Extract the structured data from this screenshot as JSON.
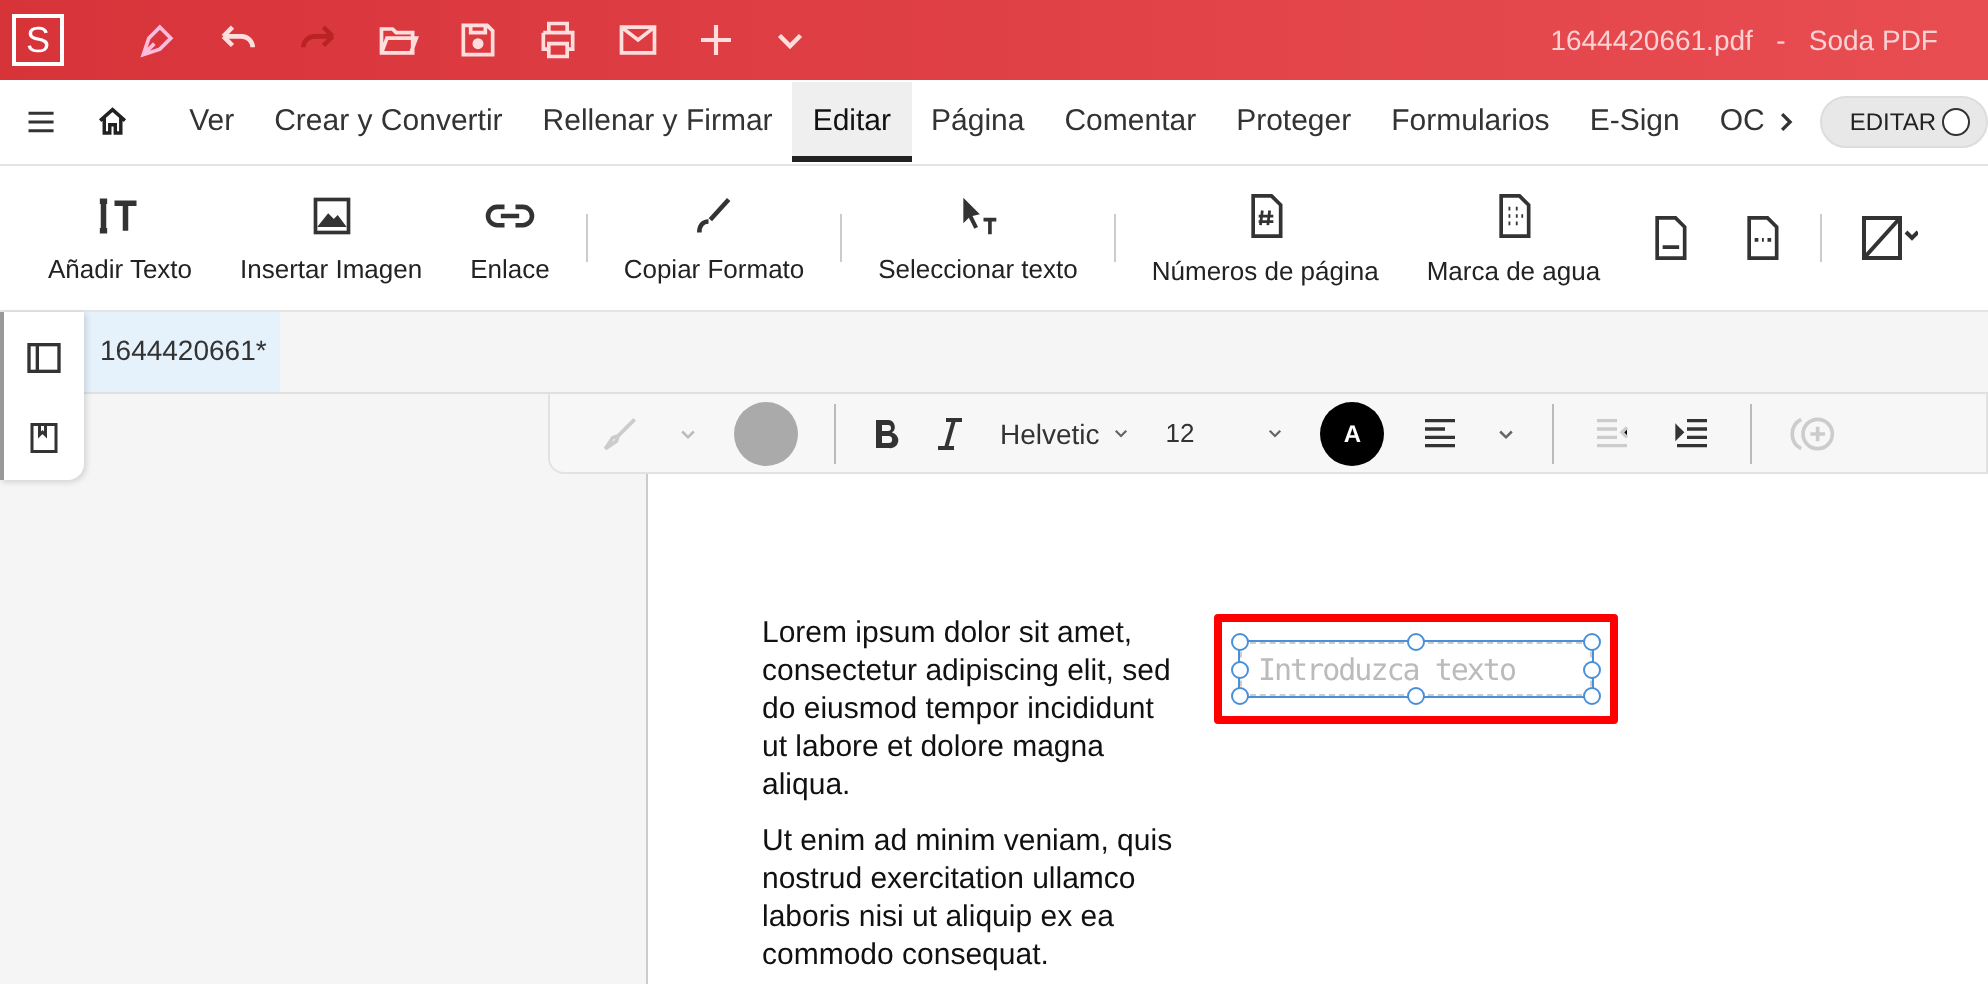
{
  "window": {
    "logo": "S",
    "title": "1644420661.pdf   -   Soda PDF"
  },
  "menu": {
    "tabs": [
      {
        "label": "Ver",
        "selected": false
      },
      {
        "label": "Crear y Convertir",
        "selected": false
      },
      {
        "label": "Rellenar y Firmar",
        "selected": false
      },
      {
        "label": "Editar",
        "selected": true
      },
      {
        "label": "Página",
        "selected": false
      },
      {
        "label": "Comentar",
        "selected": false
      },
      {
        "label": "Proteger",
        "selected": false
      },
      {
        "label": "Formularios",
        "selected": false
      },
      {
        "label": "E-Sign",
        "selected": false
      },
      {
        "label": "OC",
        "selected": false
      }
    ],
    "edit_toggle": {
      "label": "EDITAR",
      "on": false
    }
  },
  "ribbon": [
    {
      "label": "Añadir Texto"
    },
    {
      "label": "Insertar Imagen"
    },
    {
      "label": "Enlace"
    },
    {
      "label": "Copiar Formato"
    },
    {
      "label": "Seleccionar texto"
    },
    {
      "label": "Números de página"
    },
    {
      "label": "Marca de agua"
    }
  ],
  "document_tab": {
    "label": "1644420661*",
    "selected": true
  },
  "format_bar": {
    "highlighter_disabled": true,
    "fill_disabled": true,
    "font": "Helvetic",
    "size": "12",
    "text_color_label": "A",
    "outdent_disabled": true
  },
  "page": {
    "paragraphs": [
      "Lorem ipsum dolor sit amet, consectetur adipiscing elit, sed do eiusmod tempor incididunt ut labore et dolore magna aliqua.",
      "Ut enim ad minim veniam, quis nostrud exercitation ullamco laboris nisi ut aliquip ex ea commodo consequat."
    ],
    "text_box": {
      "placeholder": "Introduzca texto",
      "highlighted": true
    }
  }
}
